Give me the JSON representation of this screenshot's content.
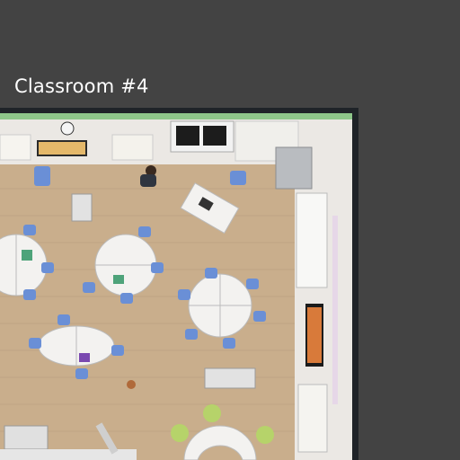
{
  "header": {
    "title": "Classroom #4"
  },
  "colors": {
    "background": "#434343",
    "wall_trim": "#8ec68a",
    "floor": "#c9ae8c",
    "wall": "#ebe8e4",
    "chair": "#6a8fd6",
    "table": "#f3f2f0",
    "outer_frame": "#1f2328"
  },
  "room": {
    "furniture": [
      "round-table-group",
      "round-table-group",
      "round-table-group",
      "round-table-group",
      "round-table-group",
      "teacher-desk",
      "storage-cart",
      "storage-cart",
      "semicircle-table",
      "bean-bag",
      "bean-bag",
      "bean-bag",
      "whiteboard",
      "tv-screen",
      "window",
      "doorway",
      "bulletin-board",
      "cabinet"
    ],
    "people": [
      "teacher"
    ]
  }
}
